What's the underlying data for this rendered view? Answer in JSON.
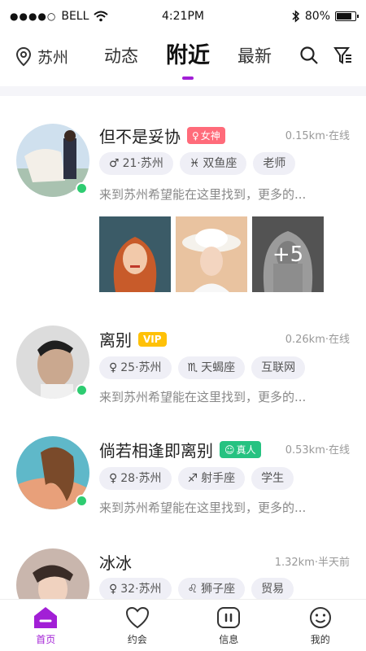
{
  "status": {
    "carrier": "BELL",
    "time": "4:21PM",
    "battery": "80%",
    "battery_level": 0.8
  },
  "header": {
    "location": "苏州",
    "tabs": [
      {
        "label": "动态"
      },
      {
        "label": "附近"
      },
      {
        "label": "最新"
      }
    ],
    "active_tab": "附近",
    "accent": "#a21fd6"
  },
  "users": [
    {
      "name": "但不是妥协",
      "badge": "女神",
      "distance": "0.15km·在线",
      "tags": [
        "21·苏州",
        "双鱼座",
        "老师"
      ],
      "bio": "来到苏州希望能在这里找到，更多的...",
      "photos_more": "+5"
    },
    {
      "name": "离别",
      "badge": "VIP",
      "distance": "0.26km·在线",
      "tags": [
        "25·苏州",
        "天蝎座",
        "互联网"
      ],
      "bio": "来到苏州希望能在这里找到，更多的..."
    },
    {
      "name": "倘若相逢即离别",
      "badge": "真人",
      "distance": "0.53km·在线",
      "tags": [
        "28·苏州",
        "射手座",
        "学生"
      ],
      "bio": "来到苏州希望能在这里找到，更多的..."
    },
    {
      "name": "冰冰",
      "distance": "1.32km·半天前",
      "tags": [
        "32·苏州",
        "狮子座",
        "贸易"
      ]
    }
  ],
  "nav": [
    {
      "label": "首页"
    },
    {
      "label": "约会"
    },
    {
      "label": "信息"
    },
    {
      "label": "我的"
    }
  ]
}
